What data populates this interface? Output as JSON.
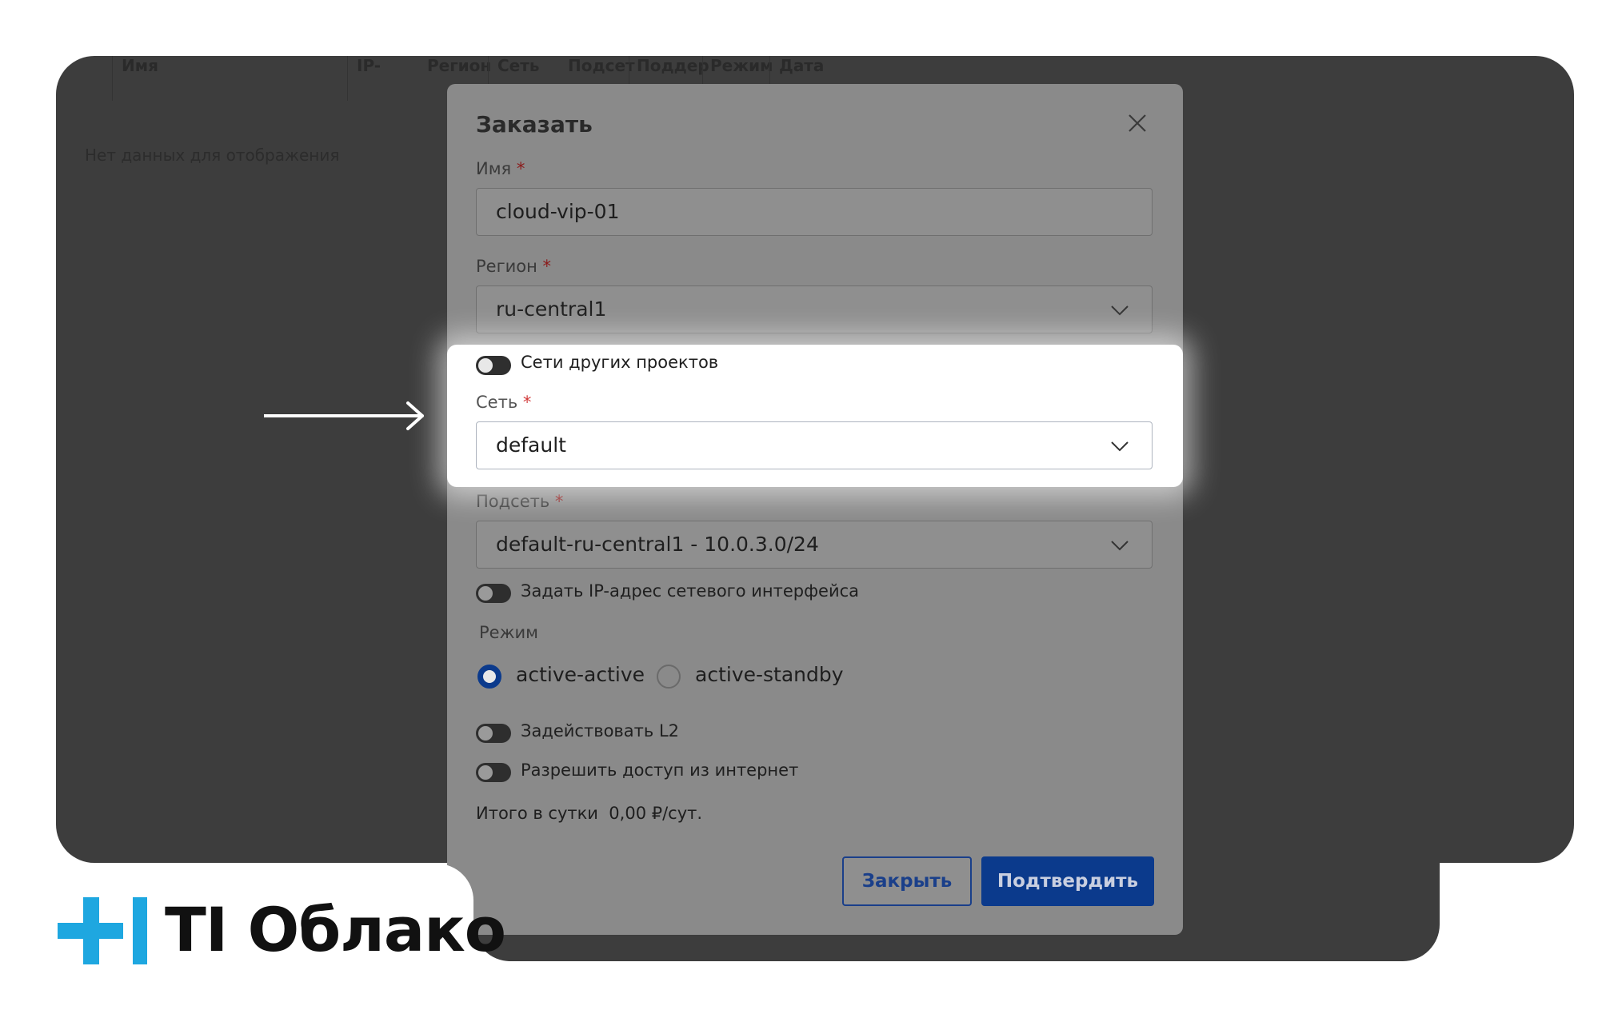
{
  "background": {
    "columns": [
      "Имя",
      "IP-",
      "Регион",
      "Сеть",
      "Подсет",
      "Поддер",
      "Режим",
      "Дата"
    ],
    "empty_text": "Нет данных для отображения"
  },
  "modal": {
    "title": "Заказать",
    "name_label": "Имя",
    "name_value": "cloud-vip-01",
    "region_label": "Регион",
    "region_value": "ru-central1",
    "other_projects_toggle": "Сети других проектов",
    "network_label": "Сеть",
    "network_value": "default",
    "subnet_label": "Подсеть",
    "subnet_value": "default-ru-central1 - 10.0.3.0/24",
    "ip_toggle": "Задать IP-адрес сетевого интерфейса",
    "mode_label": "Режим",
    "mode_options": [
      "active-active",
      "active-standby"
    ],
    "mode_selected": "active-active",
    "l2_toggle": "Задействовать L2",
    "internet_toggle": "Разрешить доступ из интернет",
    "total_label": "Итого в сутки",
    "total_value": "0,00 ₽/сут.",
    "close_button": "Закрыть",
    "confirm_button": "Подтвердить",
    "required_mark": "*"
  },
  "brand": {
    "name": "TI Облако",
    "accent_color": "#1ea7e0"
  },
  "colors": {
    "primary": "#0b3a8c",
    "overlay": "#3d3d3d"
  }
}
